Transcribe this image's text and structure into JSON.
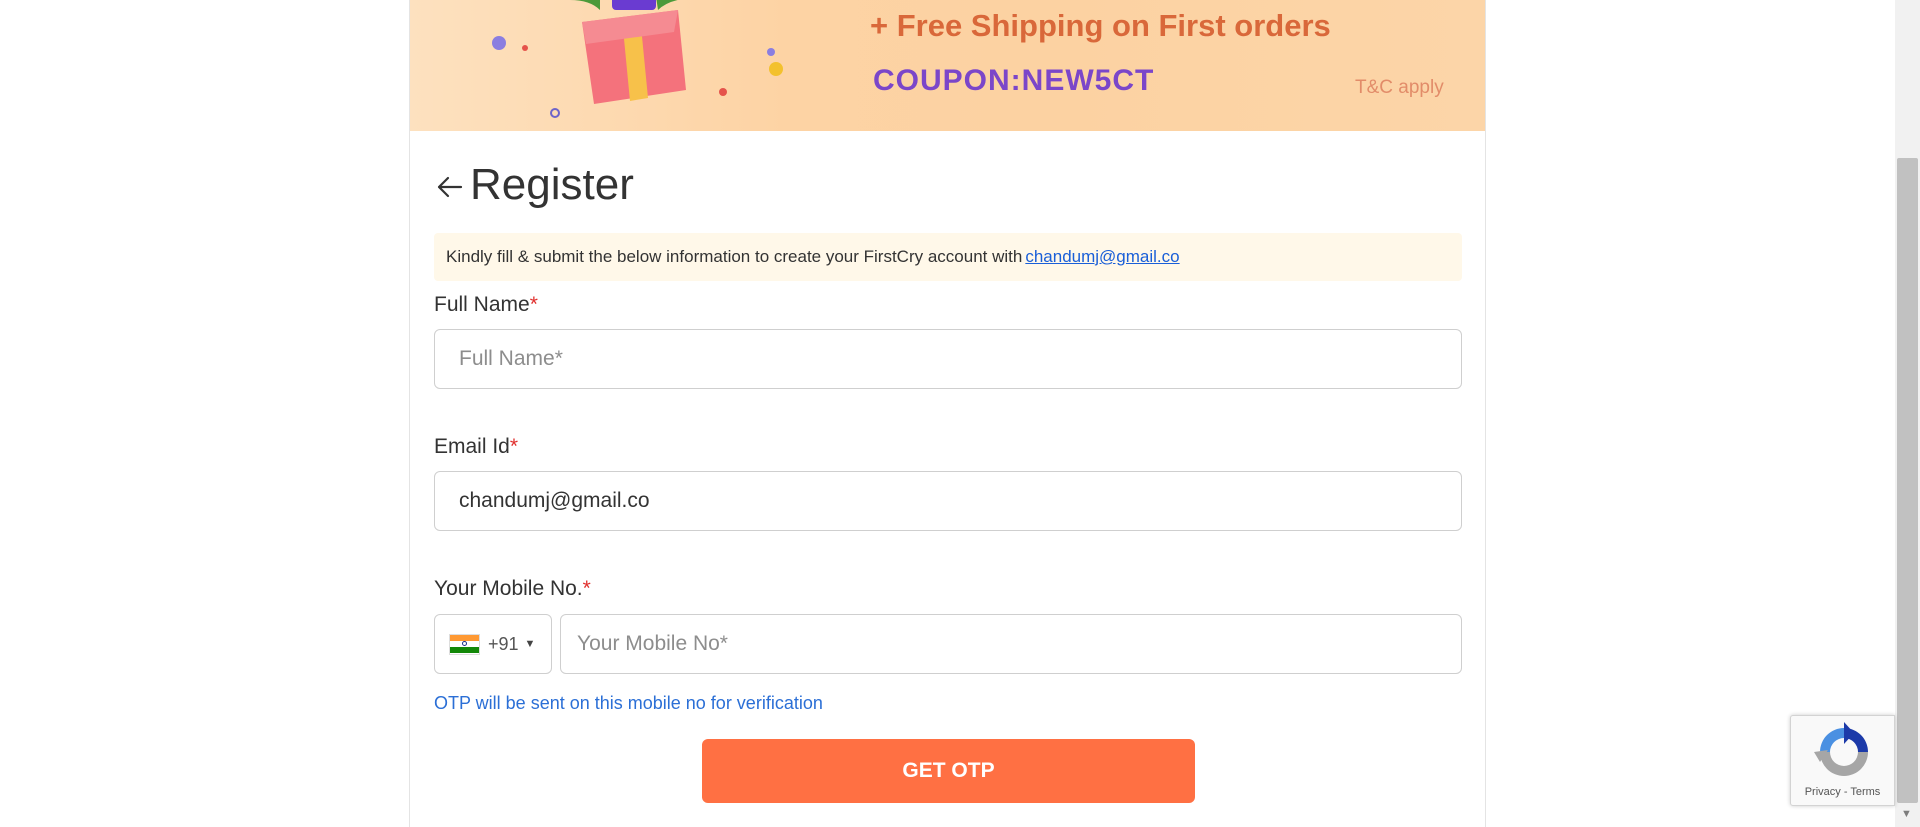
{
  "banner": {
    "line1": "+ Free Shipping on First orders",
    "coupon": "COUPON:NEW5CT",
    "tc": "T&C apply",
    "gift_text": "%"
  },
  "register": {
    "title": "Register",
    "info_text": "Kindly fill & submit the below information to create your FirstCry account with",
    "info_email": "chandumj@gmail.co"
  },
  "form": {
    "full_name": {
      "label": "Full Name",
      "required_mark": "*",
      "placeholder": "Full Name*",
      "value": ""
    },
    "email": {
      "label": "Email Id",
      "required_mark": "*",
      "value": "chandumj@gmail.co"
    },
    "mobile": {
      "label": "Your Mobile No.",
      "required_mark": "*",
      "dial_code": "+91",
      "caret": "▼",
      "placeholder": "Your Mobile No*",
      "note": "OTP will be sent on this mobile no for verification"
    },
    "submit_label": "GET OTP"
  },
  "recaptcha": {
    "privacy": "Privacy",
    "separator": " - ",
    "terms": "Terms"
  },
  "colors": {
    "accent": "#ff7043",
    "link": "#1a5fd8",
    "note": "#2b6fd6",
    "required": "#e0302e",
    "coupon": "#7b46c9",
    "banner_text": "#d9683a"
  }
}
